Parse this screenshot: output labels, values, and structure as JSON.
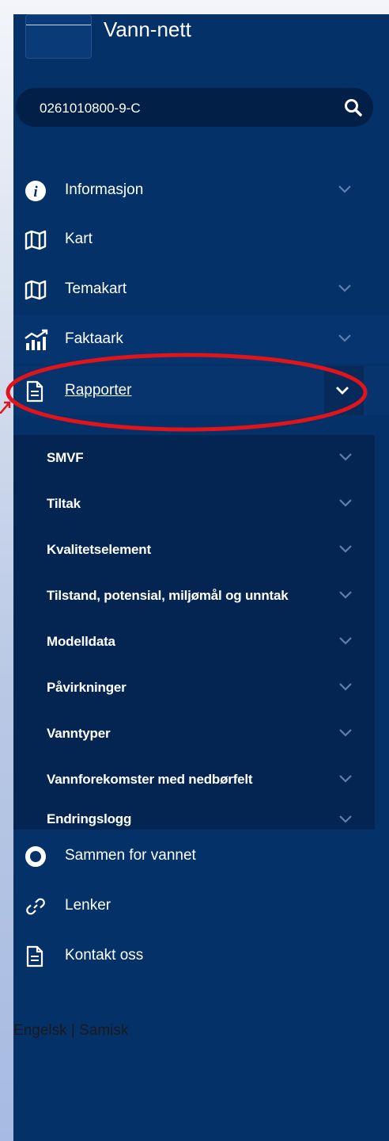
{
  "app": {
    "title": "Vann-nett"
  },
  "search": {
    "value": "0261010800-9-C",
    "icon": "search-icon"
  },
  "nav": [
    {
      "label": "Informasjon",
      "icon": "info-icon",
      "expandable": true
    },
    {
      "label": "Kart",
      "icon": "map-icon",
      "expandable": false
    },
    {
      "label": "Temakart",
      "icon": "map-icon",
      "expandable": true
    },
    {
      "label": "Faktaark",
      "icon": "chart-icon",
      "expandable": true
    },
    {
      "label": "Rapporter",
      "icon": "document-icon",
      "expandable": true,
      "expanded": true
    }
  ],
  "rapporter_sub": [
    "SMVF",
    "Tiltak",
    "Kvalitetselement",
    "Tilstand, potensial, miljømål og unntak",
    "Modelldata",
    "Påvirkninger",
    "Vanntyper",
    "Vannforekomster med nedbørfelt",
    "Endringslogg"
  ],
  "nav_bottom": [
    {
      "label": "Sammen for vannet",
      "icon": "circle-icon"
    },
    {
      "label": "Lenker",
      "icon": "link-icon"
    },
    {
      "label": "Kontakt oss",
      "icon": "document-icon"
    }
  ],
  "footer": {
    "lang_english": "Engelsk",
    "separator": "|",
    "lang_samisk": "Samisk"
  },
  "colors": {
    "sidebar": "#053169",
    "search_bg": "#021f47",
    "submenu_bg": "#042551",
    "highlight": "#e0141b"
  }
}
